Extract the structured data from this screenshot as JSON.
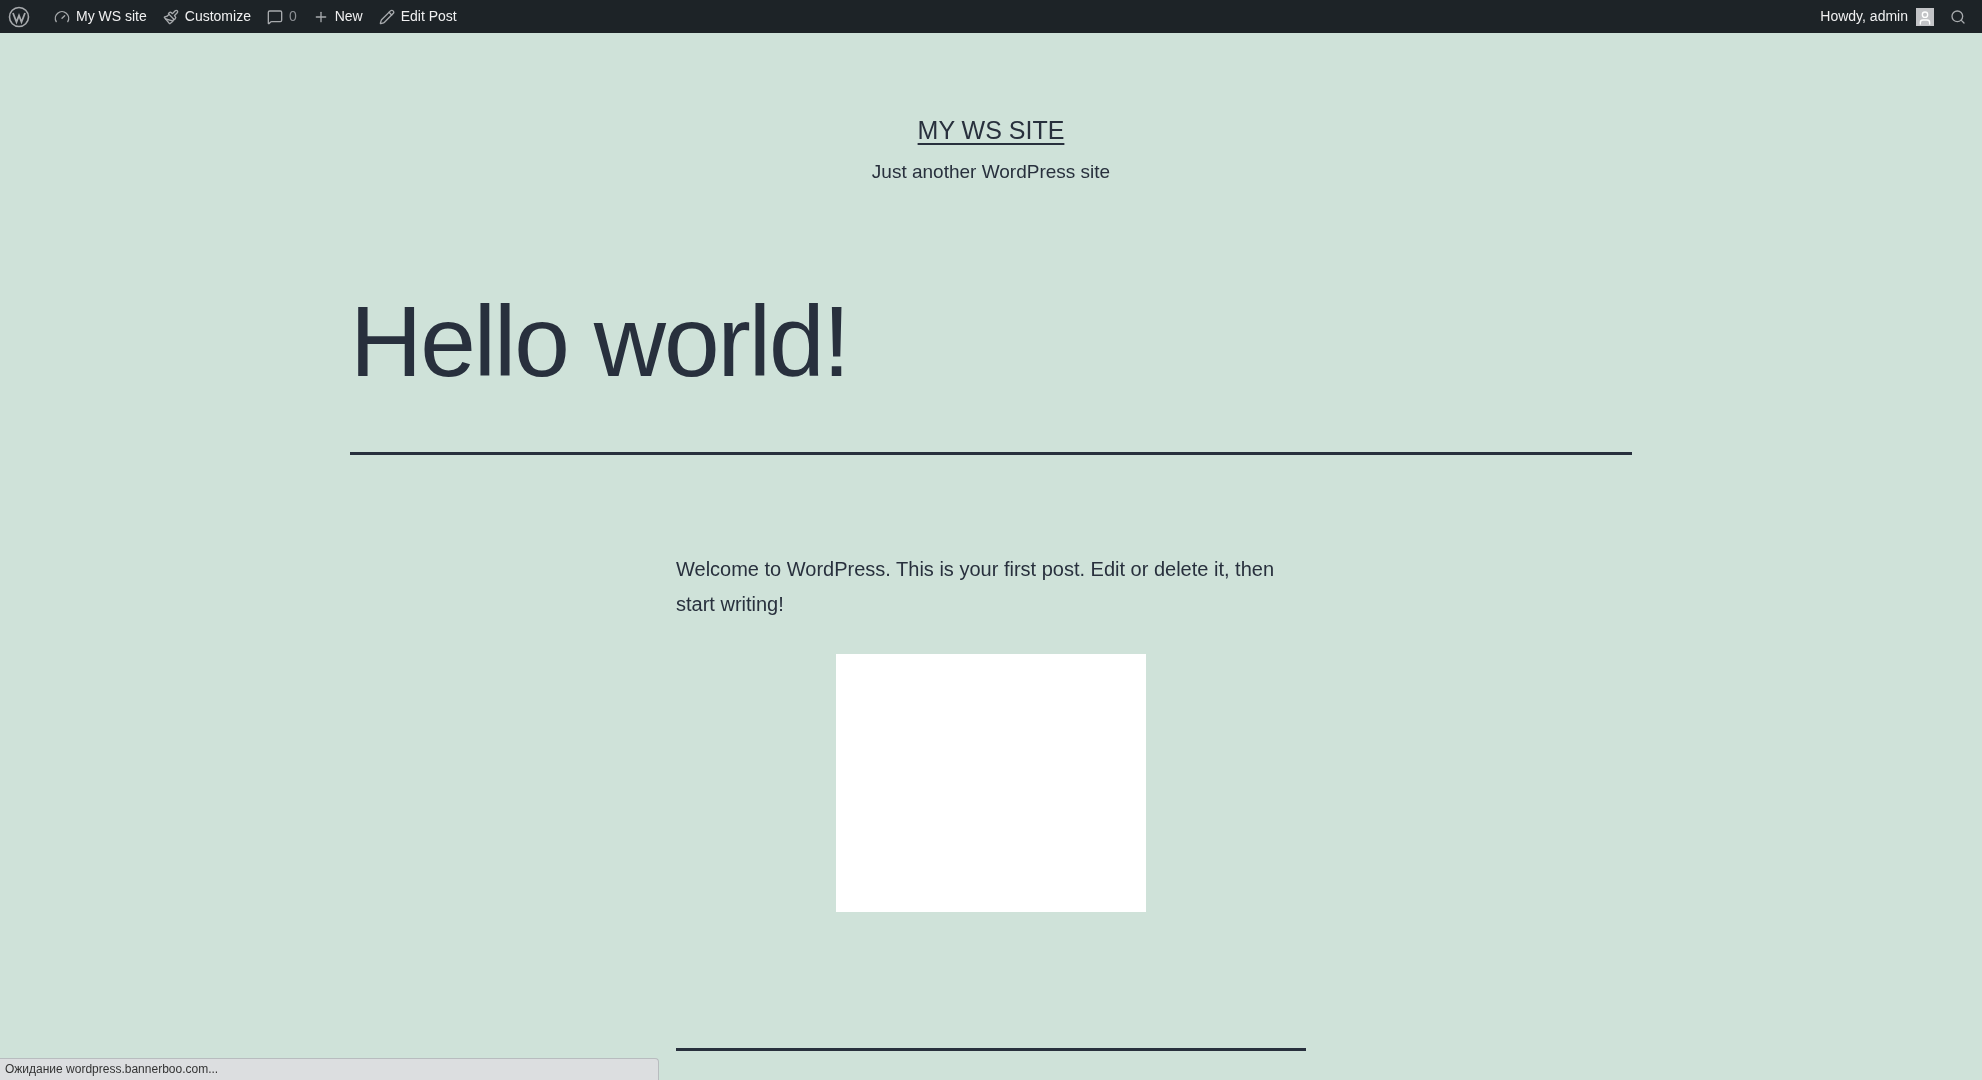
{
  "admin_bar": {
    "items": [
      {
        "kind": "site",
        "label": "My WS site"
      },
      {
        "kind": "customize",
        "label": "Customize"
      },
      {
        "kind": "comments",
        "label": "0"
      },
      {
        "kind": "new",
        "label": "New"
      },
      {
        "kind": "edit",
        "label": "Edit Post"
      }
    ],
    "greeting": "Howdy, admin"
  },
  "site": {
    "title": "MY WS SITE",
    "tagline": "Just another WordPress site"
  },
  "post": {
    "title": "Hello world!",
    "body": "Welcome to WordPress. This is your first post. Edit or delete it, then start writing!"
  },
  "status_bar": "Ожидание wordpress.bannerboo.com..."
}
